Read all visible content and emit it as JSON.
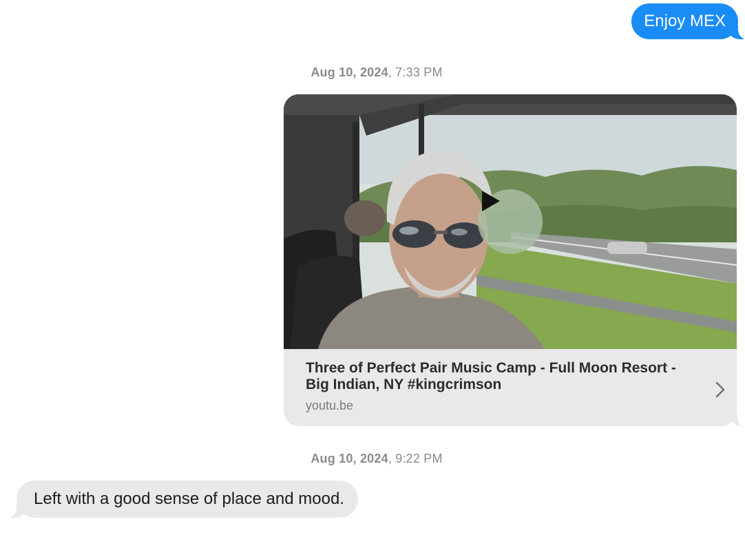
{
  "conversation": {
    "outgoing_message_1": "Enjoy MEX",
    "timestamp_1": {
      "date": "Aug 10, 2024",
      "time": "7:33 PM"
    },
    "link_preview": {
      "title": "Three of Perfect Pair Music Camp - Full Moon Resort - Big Indian, NY #kingcrimson",
      "domain": "youtu.be",
      "play_icon": "play-icon",
      "chevron_icon": "chevron-right-icon"
    },
    "timestamp_2": {
      "date": "Aug 10, 2024",
      "time": "9:22 PM"
    },
    "incoming_message_1": "Left with a good sense of place and mood."
  },
  "colors": {
    "outgoing_bubble": "#1a8cf6",
    "incoming_bubble": "#e9e9eb",
    "timestamp_text": "#8a8a8e"
  }
}
